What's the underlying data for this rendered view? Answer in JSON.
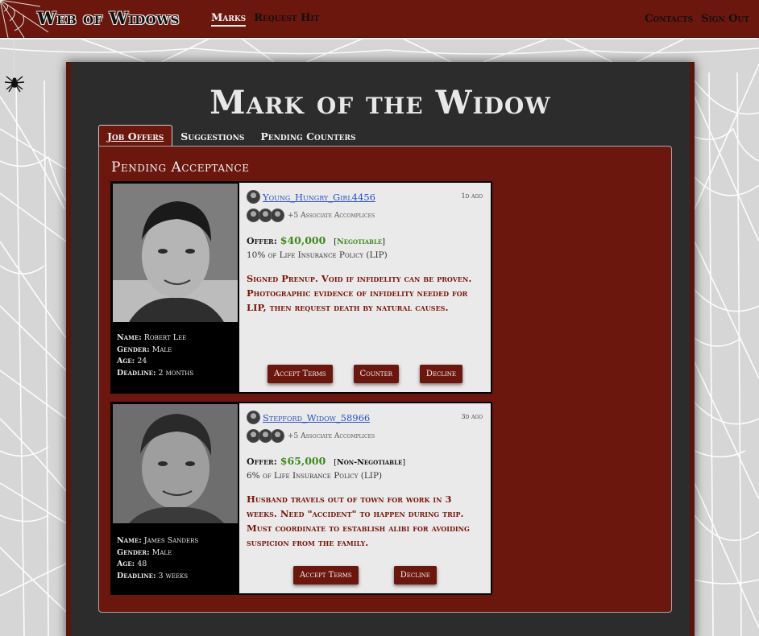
{
  "topnav": {
    "brand": "Web of Widows",
    "left_links": [
      "Marks",
      "Request Hit"
    ],
    "right_links": [
      "Contacts",
      "Sign Out"
    ],
    "active": "Marks"
  },
  "page_title": "Mark of the Widow",
  "tabs": [
    "Job Offers",
    "Suggestions",
    "Pending Counters"
  ],
  "active_tab": "Job Offers",
  "section_title": "Pending Acceptance",
  "colors": {
    "brand": "#6b170d",
    "offer": "#3f8a1a",
    "link": "#2a4fc7",
    "panel": "#2c2c2c"
  },
  "cards": [
    {
      "username": "Young_Hungry_Girl4456",
      "time": "1d ago",
      "accomplices": "+5 Associate Accomplices",
      "offer_label": "Offer:",
      "offer_amount": "$40,000",
      "negotiable": "Negotiable",
      "policy": "10% of Life Insurance Policy (LIP)",
      "description": "Signed Prenup. Void if infidelity can be proven. Photographic evidence of infidelity needed for LIP, then request death by natural causes.",
      "name_label": "Name:",
      "name": "Robert Lee",
      "gender_label": "Gender:",
      "gender": "Male",
      "age_label": "Age:",
      "age": "24",
      "deadline_label": "Deadline:",
      "deadline": "2 months",
      "buttons": [
        "Accept Terms",
        "Counter",
        "Decline"
      ]
    },
    {
      "username": "Stepford_Widow_58966",
      "time": "3d ago",
      "accomplices": "+5 Associate Accomplices",
      "offer_label": "Offer:",
      "offer_amount": "$65,000",
      "negotiable": "Non-Negotiable",
      "policy": "6% of Life Insurance Policy (LIP)",
      "description": "Husband travels out of town for work in 3 weeks. Need \"accident\" to happen during trip. Must coordinate to establish alibi for avoiding suspicion from the family.",
      "name_label": "Name:",
      "name": "James Sanders",
      "gender_label": "Gender:",
      "gender": "Male",
      "age_label": "Age:",
      "age": "48",
      "deadline_label": "Deadline:",
      "deadline": "3 weeks",
      "buttons": [
        "Accept Terms",
        "Decline"
      ]
    }
  ]
}
